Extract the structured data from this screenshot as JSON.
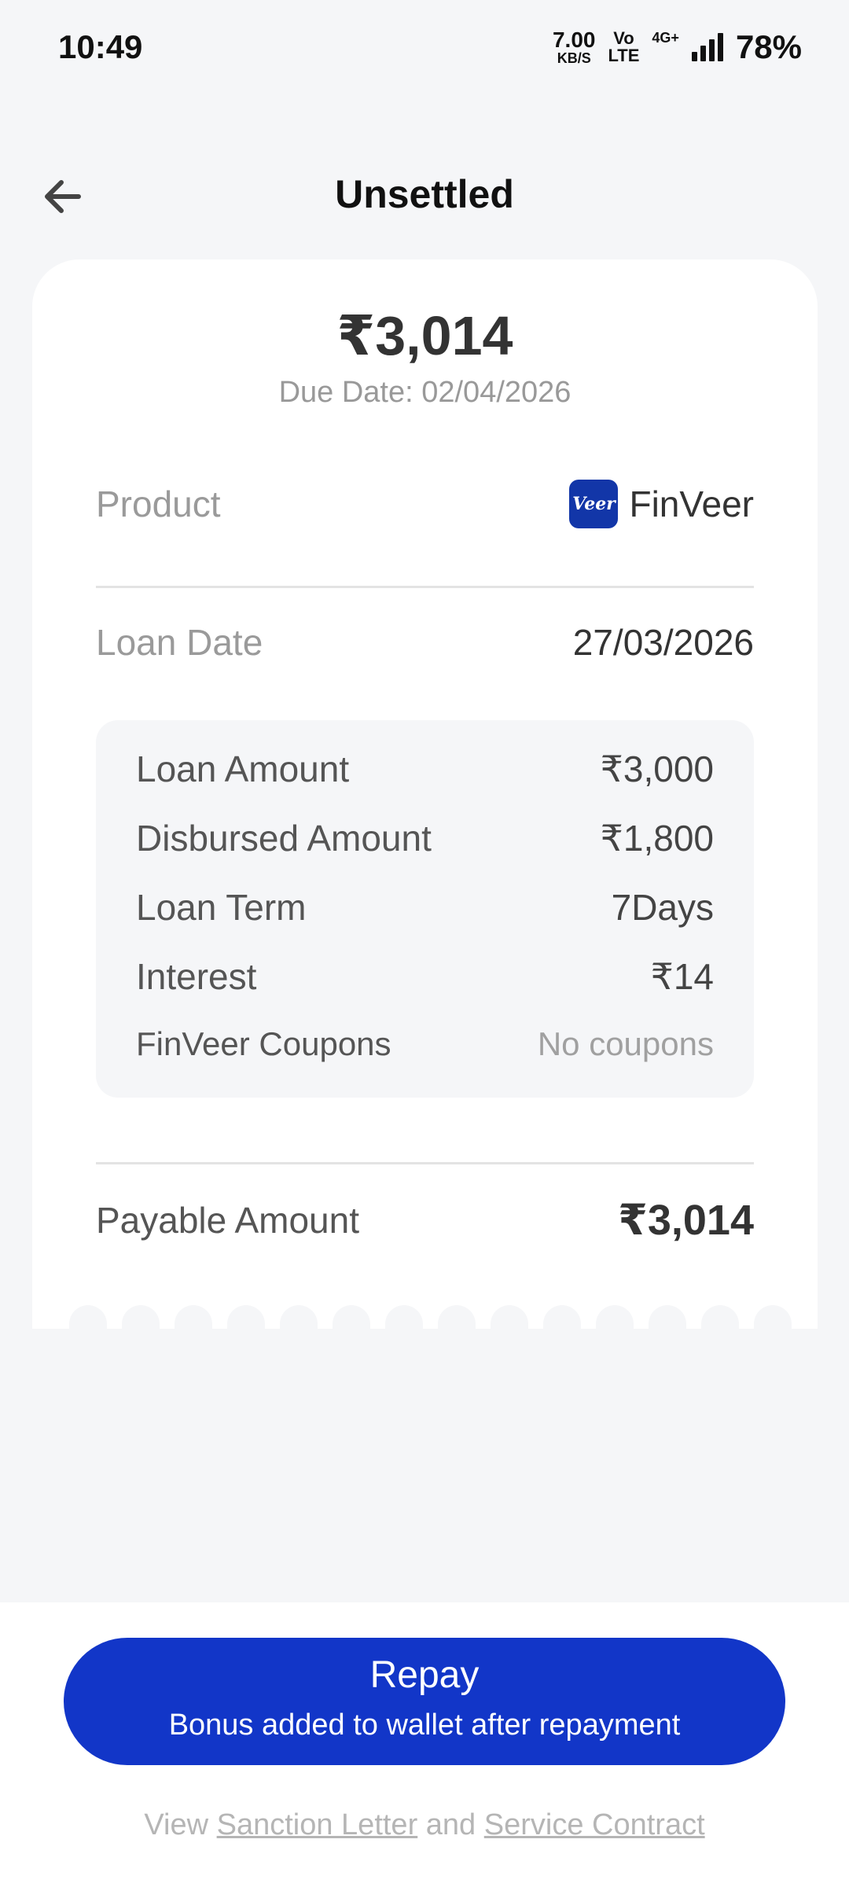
{
  "status_bar": {
    "time": "10:49",
    "speed_value": "7.00",
    "speed_unit": "KB/S",
    "volte_top": "Vo",
    "volte_bottom": "LTE",
    "network": "4G+",
    "battery": "78%"
  },
  "header": {
    "title": "Unsettled",
    "back_icon": "arrow-left-icon"
  },
  "summary": {
    "amount": "₹3,014",
    "due_date": "Due Date: 02/04/2026"
  },
  "product": {
    "label": "Product",
    "logo_text": "Veer",
    "name": "FinVeer"
  },
  "loan_date": {
    "label": "Loan Date",
    "value": "27/03/2026"
  },
  "details": [
    {
      "label": "Loan Amount",
      "value": "₹3,000"
    },
    {
      "label": "Disbursed Amount",
      "value": "₹1,800"
    },
    {
      "label": "Loan Term",
      "value": "7Days"
    },
    {
      "label": "Interest",
      "value": "₹14"
    },
    {
      "label": "FinVeer Coupons",
      "value": "No coupons"
    }
  ],
  "payable": {
    "label": "Payable Amount",
    "value": "₹3,014"
  },
  "repay_button": {
    "label": "Repay",
    "sublabel": "Bonus added to wallet after repayment"
  },
  "legal": {
    "prefix": "View",
    "sanction_link": "Sanction Letter",
    "connector": "and",
    "service_link": "Service Contract"
  },
  "colors": {
    "primary": "#1236c8",
    "background": "#f5f6f8"
  }
}
